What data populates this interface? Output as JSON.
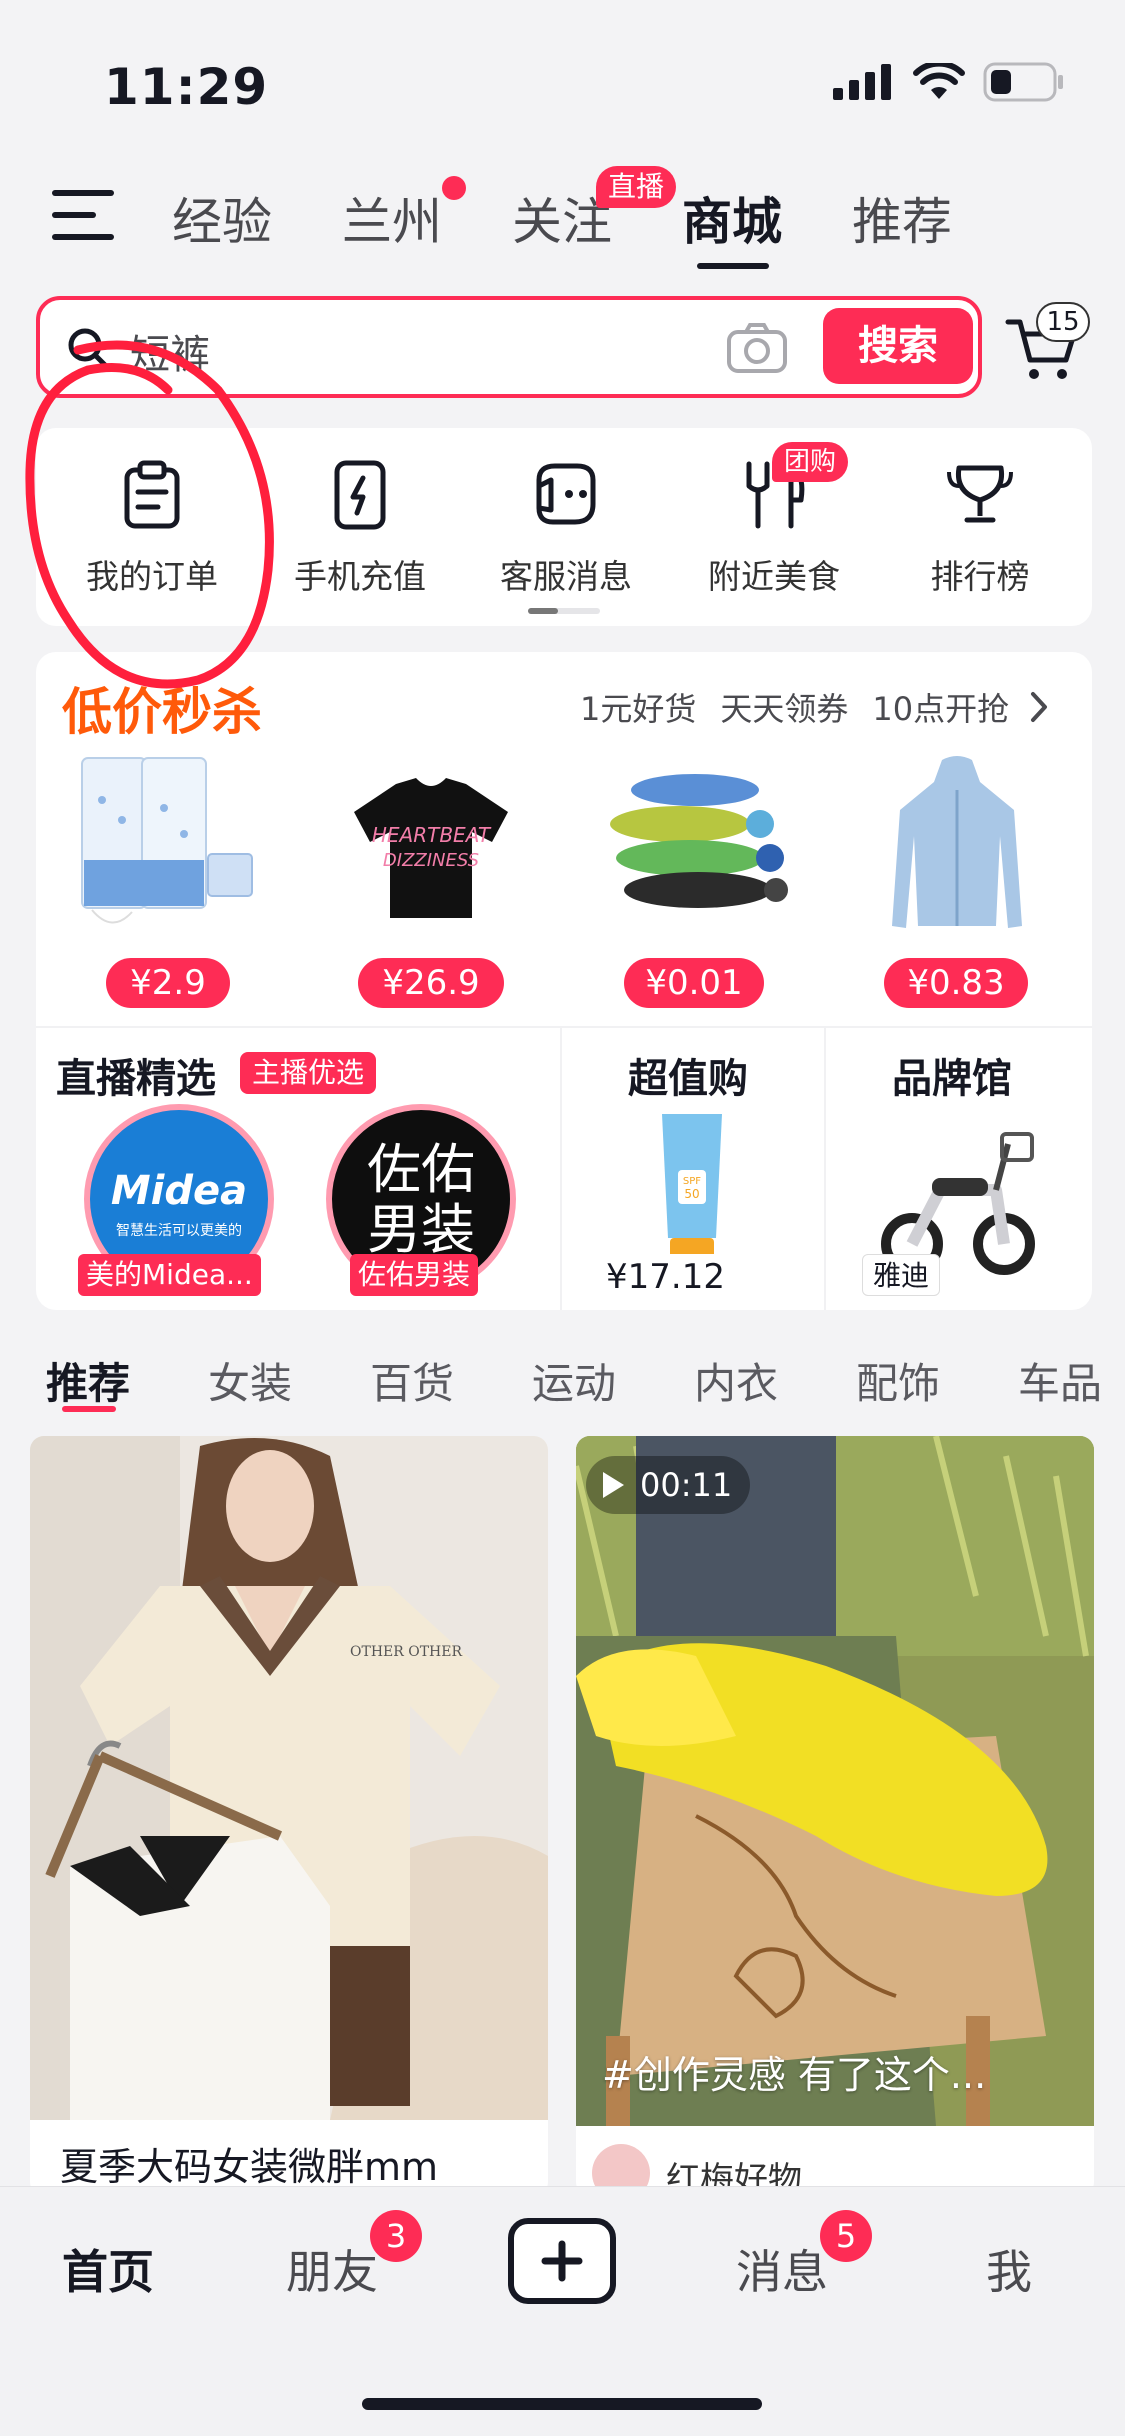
{
  "status_bar": {
    "time": "11:29"
  },
  "top_tabs": [
    {
      "label": "经验"
    },
    {
      "label": "兰州"
    },
    {
      "label": "关注",
      "badge": "直播"
    },
    {
      "label": "商城"
    },
    {
      "label": "推荐"
    }
  ],
  "search": {
    "query": "短裤",
    "button": "搜索",
    "cart_count": "15"
  },
  "quick_entries": [
    {
      "label": "我的订单",
      "icon": "order-clipboard-icon"
    },
    {
      "label": "手机充值",
      "icon": "phone-recharge-icon"
    },
    {
      "label": "客服消息",
      "icon": "customer-service-icon"
    },
    {
      "label": "附近美食",
      "icon": "fork-knife-icon",
      "badge": "团购"
    },
    {
      "label": "排行榜",
      "icon": "trophy-icon"
    }
  ],
  "flash_sale": {
    "title": "低价秒杀",
    "links": [
      "1元好货",
      "天天领券",
      "10点开抢"
    ],
    "products": [
      {
        "price": "¥2.9",
        "item": "tissue-pack"
      },
      {
        "price": "¥26.9",
        "item": "black-tshirt"
      },
      {
        "price": "¥0.01",
        "item": "garbage-bags"
      },
      {
        "price": "¥0.83",
        "item": "sun-jacket"
      }
    ],
    "tshirt_print": [
      "HEARTBEAT",
      "DIZZINESS"
    ]
  },
  "live_select": {
    "title": "直播精选",
    "badge": "主播优选",
    "shops": [
      {
        "name": "美的Midea...",
        "logo_text": "Midea",
        "logo_sub": "智慧生活可以更美的"
      },
      {
        "name": "佐佑男装",
        "logo_text": "佐佑男装"
      }
    ]
  },
  "value_buy": {
    "title": "超值购",
    "price": "¥17.12"
  },
  "brand_hall": {
    "title": "品牌馆",
    "brand": "雅迪"
  },
  "category_tabs": [
    "推荐",
    "女装",
    "百货",
    "运动",
    "内衣",
    "配饰",
    "车品"
  ],
  "feed": [
    {
      "title": "夏季大码女装微胖mm",
      "shirt_print": "OTHER OTHER"
    },
    {
      "duration": "00:11",
      "hashtag": "#创作灵感 有了这个...",
      "author": "红梅好物"
    }
  ],
  "bottom_nav": [
    {
      "label": "首页"
    },
    {
      "label": "朋友",
      "badge": "3"
    },
    {
      "label": "消息",
      "badge": "5"
    },
    {
      "label": "我"
    }
  ],
  "colors": {
    "accent": "#fe2c55",
    "flash_orange": "#ff5a0a",
    "annotation_red": "#ff1f3d"
  }
}
